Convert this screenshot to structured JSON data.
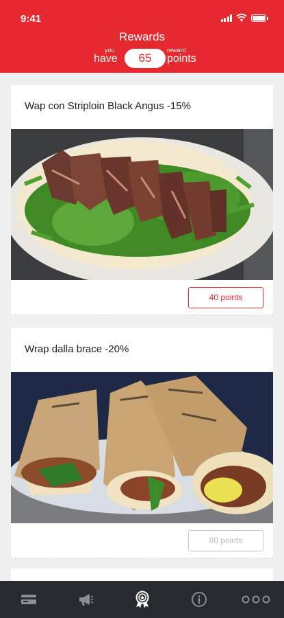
{
  "status_bar": {
    "time": "9:41"
  },
  "header": {
    "title": "Rewards",
    "you_label": "you",
    "have_label": "have",
    "points_value": "65",
    "reward_label": "reward",
    "points_label": "points"
  },
  "rewards": [
    {
      "title": "Wap con Striploin Black Angus  -15%",
      "points_label": "40 points",
      "enabled": true,
      "image": "steak-wrap-photo"
    },
    {
      "title": "Wrap dalla brace -20%",
      "points_label": "80 points",
      "enabled": false,
      "image": "grilled-wraps-photo"
    }
  ],
  "tabbar": {
    "items": [
      "card-icon",
      "megaphone-icon",
      "award-icon",
      "info-icon",
      "more-icon"
    ],
    "active_index": 2
  },
  "colors": {
    "brand_red": "#e5292e",
    "tabbar_bg": "#272a2f",
    "tab_active": "#ffffff",
    "tab_inactive": "#8b8e93",
    "disabled_text": "#b8b8b8"
  }
}
